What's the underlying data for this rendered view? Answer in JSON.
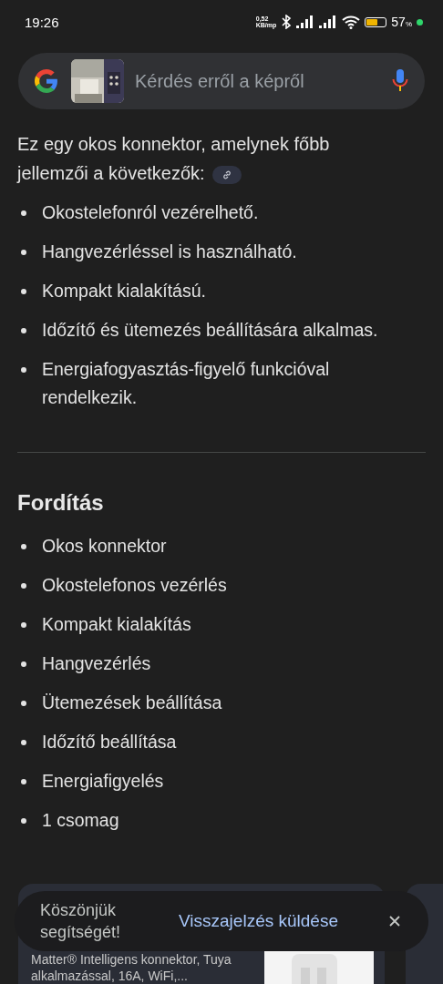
{
  "status_bar": {
    "time": "19:26",
    "net_speed_value": "0,52",
    "net_speed_unit": "KB/mp",
    "battery": "57",
    "battery_unit": "%"
  },
  "search": {
    "placeholder": "Kérdés erről a képről"
  },
  "intro": "Ez egy okos konnektor, amelynek főbb jellemzői a következők:",
  "features": [
    "Okostelefonról vezérelhető.",
    "Hangvezérléssel is használható.",
    "Kompakt kialakítású.",
    "Időzítő és ütemezés beállítására alkalmas.",
    "Energiafogyasztás-figyelő funkcióval rendelkezik."
  ],
  "translation": {
    "heading": "Fordítás",
    "items": [
      "Okos konnektor",
      "Okostelefonos vezérlés",
      "Kompakt kialakítás",
      "Hangvezérlés",
      "Ütemezések beállítása",
      "Időzítő beállítása",
      "Energiafigyelés",
      "1 csomag"
    ]
  },
  "product_card": {
    "title": "Matter® Intelligens konnektor, Tuya alkalmazással, 16A, WiFi,..."
  },
  "snackbar": {
    "message": "Köszönjük segítségét!",
    "action": "Visszajelzés küldése"
  }
}
